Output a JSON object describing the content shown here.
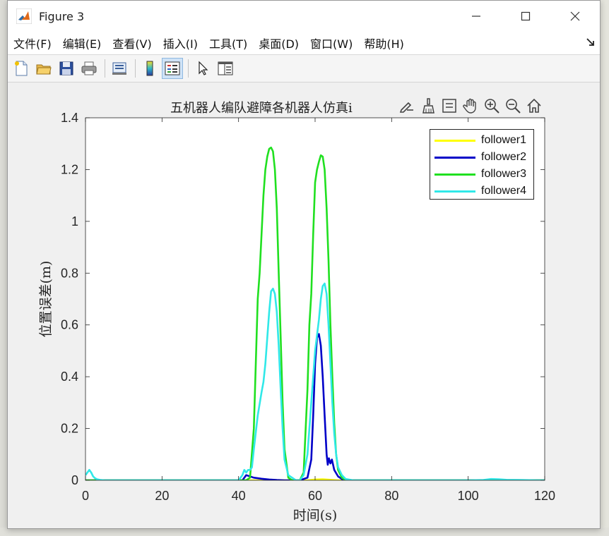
{
  "window": {
    "title": "Figure 3",
    "controls": [
      "minimize-icon",
      "maximize-icon",
      "close-icon"
    ]
  },
  "menu": {
    "items": [
      "文件(F)",
      "编辑(E)",
      "查看(V)",
      "插入(I)",
      "工具(T)",
      "桌面(D)",
      "窗口(W)",
      "帮助(H)"
    ]
  },
  "toolbar": {
    "icons": [
      "new-figure-icon",
      "open-file-icon",
      "save-icon",
      "print-icon",
      "print-preview-icon",
      "colorbar-icon",
      "legend-icon",
      "pointer-icon",
      "property-inspector-icon"
    ]
  },
  "axes_toolbar": {
    "icons": [
      "brush-edit-icon",
      "data-brush-icon",
      "data-tips-icon",
      "pan-hand-icon",
      "zoom-in-icon",
      "zoom-out-icon",
      "home-icon"
    ]
  },
  "colors": {
    "follower1": "#ffff00",
    "follower2": "#0000c8",
    "follower3": "#20e020",
    "follower4": "#30e8e8"
  },
  "chart_data": {
    "type": "line",
    "title": "五机器人编队避障各机器人仿真i",
    "xlabel": "时间(s)",
    "ylabel": "位置误差(m)",
    "xlim": [
      0,
      120
    ],
    "ylim": [
      0,
      1.4
    ],
    "xticks": [
      "0",
      "20",
      "40",
      "60",
      "80",
      "100",
      "120"
    ],
    "yticks": [
      "0",
      "0.2",
      "0.4",
      "0.6",
      "0.8",
      "1",
      "1.2",
      "1.4"
    ],
    "legend_position": "top-right",
    "series": [
      {
        "name": "follower1",
        "color": "#ffff00",
        "x": [
          0,
          40,
          58,
          60,
          62,
          64,
          66,
          120
        ],
        "y": [
          0,
          0,
          0,
          0.003,
          0.004,
          0.002,
          0,
          0
        ]
      },
      {
        "name": "follower2",
        "color": "#0000c8",
        "x": [
          0,
          41,
          42,
          44,
          46,
          48,
          50,
          52,
          56,
          58,
          59,
          59.5,
          60,
          60.5,
          61,
          61.5,
          62,
          62.5,
          63,
          63.3,
          63.6,
          64,
          64.4,
          65,
          66,
          67,
          69,
          72,
          120
        ],
        "y": [
          0,
          0,
          0.02,
          0.01,
          0.006,
          0.003,
          0.001,
          0,
          0,
          0.01,
          0.08,
          0.25,
          0.45,
          0.55,
          0.565,
          0.52,
          0.4,
          0.25,
          0.1,
          0.06,
          0.085,
          0.065,
          0.08,
          0.04,
          0.015,
          0.005,
          0,
          0,
          0
        ]
      },
      {
        "name": "follower3",
        "color": "#20e020",
        "x": [
          0,
          42,
          43,
          44,
          45,
          45.5,
          46,
          46.5,
          47,
          47.5,
          48,
          48.5,
          49,
          49.5,
          50,
          50.5,
          51,
          51.5,
          52,
          53,
          54,
          56,
          57,
          58,
          58.5,
          59,
          59.5,
          60,
          60.5,
          61,
          61.5,
          62,
          62.5,
          63,
          63.5,
          64,
          64.5,
          65,
          65.5,
          66,
          67,
          68,
          70,
          120
        ],
        "y": [
          0,
          0,
          0.01,
          0.2,
          0.7,
          0.8,
          0.95,
          1.1,
          1.2,
          1.25,
          1.28,
          1.285,
          1.27,
          1.2,
          1.05,
          0.8,
          0.55,
          0.3,
          0.12,
          0.01,
          0,
          0,
          0.03,
          0.35,
          0.6,
          0.72,
          0.95,
          1.15,
          1.2,
          1.23,
          1.255,
          1.25,
          1.2,
          1.05,
          0.85,
          0.6,
          0.4,
          0.22,
          0.1,
          0.04,
          0.01,
          0,
          0,
          0
        ]
      },
      {
        "name": "follower4",
        "color": "#30e8e8",
        "x": [
          0,
          0.5,
          1,
          1.5,
          2,
          2.5,
          3,
          4,
          5,
          40,
          41,
          41.5,
          42,
          42.5,
          43,
          43.5,
          44,
          45,
          46,
          46.5,
          47,
          47.5,
          48,
          48.5,
          49,
          49.5,
          50,
          50.5,
          51,
          51.5,
          52,
          53,
          55,
          56,
          57,
          58,
          58.5,
          59,
          59.5,
          60,
          60.5,
          61,
          61.5,
          62,
          62.5,
          63,
          63.5,
          64,
          64.5,
          65,
          65.5,
          66,
          67,
          68,
          70,
          80,
          100,
          104,
          106,
          108,
          110,
          114,
          118,
          120
        ],
        "y": [
          0.02,
          0.03,
          0.04,
          0.03,
          0.015,
          0.008,
          0.004,
          0.001,
          0,
          0,
          0.02,
          0.04,
          0.03,
          0.04,
          0.04,
          0.05,
          0.12,
          0.25,
          0.34,
          0.38,
          0.45,
          0.55,
          0.65,
          0.73,
          0.74,
          0.72,
          0.65,
          0.52,
          0.35,
          0.2,
          0.08,
          0.02,
          0,
          0,
          0.02,
          0.1,
          0.2,
          0.3,
          0.4,
          0.5,
          0.56,
          0.62,
          0.7,
          0.75,
          0.76,
          0.72,
          0.6,
          0.45,
          0.3,
          0.18,
          0.1,
          0.05,
          0.02,
          0.005,
          0,
          0,
          0,
          0.001,
          0.005,
          0.004,
          0.002,
          0.001,
          0,
          0
        ]
      }
    ]
  }
}
